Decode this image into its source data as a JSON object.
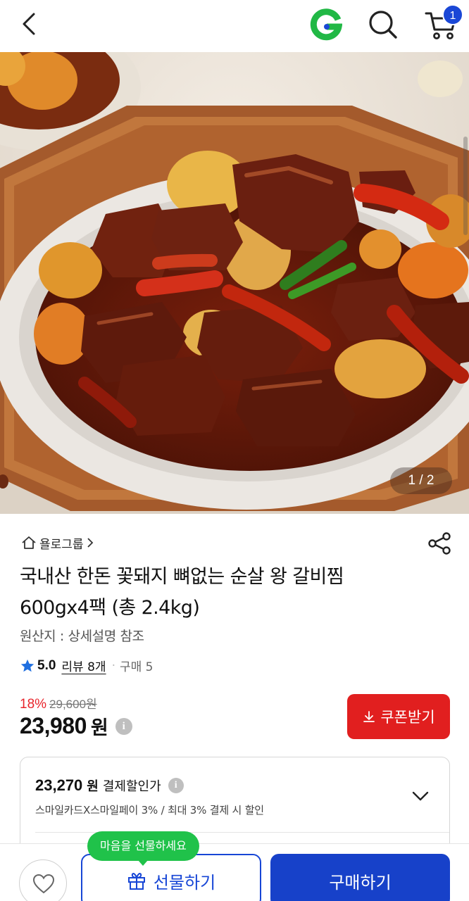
{
  "header": {
    "cart_count": "1",
    "icons": [
      "back-icon",
      "gmarket-g-logo",
      "search-icon",
      "cart-icon"
    ],
    "logo_color": "#21b845"
  },
  "gallery": {
    "page_indicator": "1 / 2"
  },
  "product": {
    "seller": "욜로그룹",
    "title_line1": "국내산 한돈 꽃돼지 뼈없는 순살 왕 갈비찜",
    "title_line2": "600gx4팩 (총 2.4kg)",
    "origin": "원산지 : 상세설명 참조",
    "rating": "5.0",
    "review_label": "리뷰 8개",
    "purchase_label": "구매 5",
    "discount_rate": "18%",
    "original_price": "29,600원",
    "price": "23,980",
    "price_unit": "원"
  },
  "coupon": {
    "label": "쿠폰받기",
    "color": "#e11f1f"
  },
  "benefit": {
    "amount": "23,270",
    "unit": "원",
    "label": "결제할인가",
    "detail": "스마일카드X스마일페이 3% / 최대 3% 결제 시 할인"
  },
  "bottom": {
    "tooltip": "마음을 선물하세요",
    "gift_label": "선물하기",
    "buy_label": "구매하기",
    "accent": "#1741c9"
  }
}
